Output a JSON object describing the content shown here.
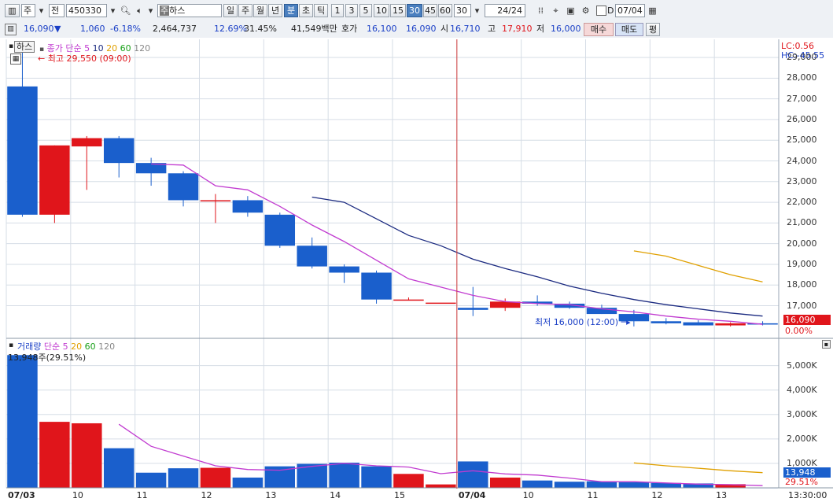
{
  "toolbar": {
    "market_left": "주",
    "mode": "전",
    "code": "450330",
    "stock_name": "하스",
    "period_buttons": [
      "일",
      "주",
      "월",
      "년",
      "분",
      "초",
      "틱"
    ],
    "active_period": "분",
    "interval_buttons": [
      "1",
      "3",
      "5",
      "10",
      "15",
      "30",
      "45",
      "60"
    ],
    "active_interval": "30",
    "interval_select": "30",
    "page_counter": "24",
    "page_total": "/24",
    "date_check_label": "D",
    "date_value": "07/04"
  },
  "quote": {
    "price": "16,090",
    "change": "1,060",
    "change_rate": "-6.18%",
    "volume": "2,464,737",
    "turnover1": "12.69%",
    "turnover2": "31.45%",
    "amount": "41,549백만",
    "bid_label": "호가",
    "bid1": "16,100",
    "bid2": "16,090",
    "open_label": "시",
    "open": "16,710",
    "high_label": "고",
    "high": "17,910",
    "low_label": "저",
    "low": "16,000",
    "buy_button": "매수",
    "sell_button": "매도",
    "eval_button": "평"
  },
  "price_panel": {
    "stock_tag": "하스",
    "legend": [
      {
        "label": "종가",
        "color": "#c13bd0"
      },
      {
        "label": "단순 5",
        "color": "#c13bd0"
      },
      {
        "label": "10",
        "color": "#1b2a80"
      },
      {
        "label": "20",
        "color": "#e0a000"
      },
      {
        "label": "60",
        "color": "#19a019"
      },
      {
        "label": "120",
        "color": "#888888"
      }
    ],
    "high_marker": "최고 29,550 (09:00)",
    "low_marker": "최저 16,000 (12:00)",
    "lc_label": "LC:0.56",
    "hc_label": "HC:-45.55",
    "current_price_tag": "16,090",
    "current_rate_tag": "0.00%",
    "y_ticks": [
      "29,000",
      "28,000",
      "27,000",
      "26,000",
      "25,000",
      "24,000",
      "23,000",
      "22,000",
      "21,000",
      "20,000",
      "19,000",
      "18,000",
      "17,000"
    ]
  },
  "volume_panel": {
    "legend": [
      {
        "label": "거래량",
        "color": "#1a3fc6"
      },
      {
        "label": "단순 5",
        "color": "#c13bd0"
      },
      {
        "label": "20",
        "color": "#e0a000"
      },
      {
        "label": "60",
        "color": "#19a019"
      },
      {
        "label": "120",
        "color": "#888888"
      }
    ],
    "max_marker": "13,948주(29.51%)",
    "current_volume_tag": "13,948",
    "current_volume_rate": "29.51%",
    "y_ticks": [
      "5,000K",
      "4,000K",
      "3,000K",
      "2,000K",
      "1,000K"
    ]
  },
  "time_axis": {
    "labels": [
      "07/03",
      "10",
      "11",
      "12",
      "13",
      "14",
      "15",
      "07/04",
      "10",
      "11",
      "12",
      "13"
    ],
    "clock": "13:30:00"
  },
  "colors": {
    "up": "#e0151b",
    "down": "#1a5fcc",
    "ma5": "#c13bd0",
    "ma10": "#1b2a80",
    "ma20": "#e0a000",
    "grid": "#d6dde6"
  },
  "chart_data": {
    "type": "candlestick",
    "x": [
      "07/03 09:00",
      "09:30",
      "10:00",
      "10:30",
      "11:00",
      "11:30",
      "12:00",
      "12:30",
      "13:00",
      "13:30",
      "14:00",
      "14:30",
      "15:00",
      "15:30",
      "07/04 09:00",
      "09:30",
      "10:00",
      "10:30",
      "11:00",
      "11:30",
      "12:00",
      "12:30",
      "13:00",
      "13:30"
    ],
    "open": [
      27600,
      21400,
      24700,
      25100,
      23900,
      23400,
      22100,
      22100,
      21400,
      19900,
      18900,
      18600,
      17300,
      17150,
      16900,
      16900,
      17200,
      17100,
      16900,
      16600,
      16250,
      16200,
      16050,
      16150
    ],
    "high": [
      29550,
      24750,
      25200,
      25200,
      24150,
      23500,
      22400,
      22300,
      21500,
      20300,
      19000,
      18700,
      17400,
      17150,
      17910,
      17350,
      17500,
      17200,
      17050,
      16800,
      16400,
      16300,
      16200,
      16250
    ],
    "low": [
      21300,
      21000,
      22600,
      23200,
      22800,
      21800,
      21000,
      21300,
      19800,
      18800,
      18100,
      17100,
      17250,
      17150,
      16500,
      16750,
      17000,
      16850,
      16600,
      16000,
      16100,
      16050,
      16000,
      16050
    ],
    "close": [
      21400,
      24750,
      25100,
      23900,
      23400,
      22100,
      22100,
      21500,
      19900,
      18900,
      18600,
      17300,
      17300,
      17150,
      16800,
      17200,
      17100,
      16900,
      16600,
      16250,
      16150,
      16050,
      16150,
      16090
    ],
    "ma5": [
      null,
      null,
      null,
      null,
      23850,
      23800,
      22800,
      22600,
      21800,
      20900,
      20100,
      19200,
      18300,
      17900,
      17500,
      17200,
      17100,
      17050,
      16850,
      16700,
      16500,
      16350,
      16250,
      16100
    ],
    "ma10": [
      null,
      null,
      null,
      null,
      null,
      null,
      null,
      null,
      null,
      22250,
      22000,
      21200,
      20400,
      19900,
      19250,
      18800,
      18400,
      17950,
      17600,
      17300,
      17050,
      16850,
      16650,
      16500
    ],
    "ma20": [
      null,
      null,
      null,
      null,
      null,
      null,
      null,
      null,
      null,
      null,
      null,
      null,
      null,
      null,
      null,
      null,
      null,
      null,
      null,
      19650,
      19400,
      18950,
      18500,
      18150
    ],
    "volume": [
      5430,
      2700,
      2640,
      1620,
      620,
      800,
      820,
      420,
      880,
      980,
      1030,
      880,
      570,
      140,
      1080,
      420,
      300,
      250,
      270,
      230,
      200,
      180,
      150,
      14
    ],
    "volume_ma5": [
      null,
      null,
      null,
      2600,
      1700,
      1300,
      900,
      750,
      720,
      880,
      1000,
      900,
      850,
      580,
      700,
      570,
      520,
      400,
      250,
      250,
      200,
      150,
      130,
      90
    ],
    "volume_ma20": [
      null,
      null,
      null,
      null,
      null,
      null,
      null,
      null,
      null,
      null,
      null,
      null,
      null,
      null,
      null,
      null,
      null,
      null,
      null,
      1020,
      900,
      800,
      700,
      620
    ],
    "price_ylim": [
      15500,
      29800
    ],
    "volume_ylim": [
      0,
      5600
    ],
    "volume_unit": "K",
    "grid": true
  }
}
